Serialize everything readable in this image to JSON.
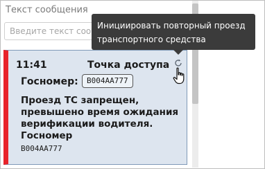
{
  "message_section": {
    "label": "Текст сообщения",
    "input_placeholder": "Введите текст сообщения",
    "input_value": ""
  },
  "tooltip": {
    "line1": "Инициировать повторный проезд",
    "line2": "транспортного средства"
  },
  "event_card": {
    "time": "11:41",
    "access_point": "Точка доступа",
    "plate_label": "Госномер:",
    "plate_value": "В004АА777",
    "message": "Проезд ТС запрещен, превышено время ожидания верификации водителя. Госномер",
    "message_plate": "В004АА777",
    "status_color": "#e8232a",
    "card_background": "#dde5ef",
    "retry_icon": "refresh-icon"
  },
  "colors": {
    "tooltip_background": "#3b3b3b",
    "card_border": "#7f99b8"
  }
}
